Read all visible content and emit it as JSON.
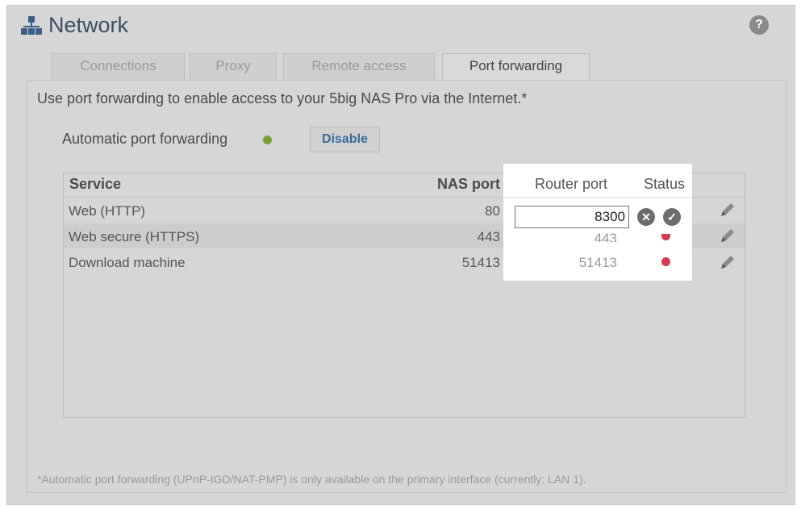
{
  "window": {
    "title": "Network",
    "help_label": "?"
  },
  "tabs": [
    {
      "label": "Connections",
      "active": false
    },
    {
      "label": "Proxy",
      "active": false
    },
    {
      "label": "Remote access",
      "active": false
    },
    {
      "label": "Port forwarding",
      "active": true
    }
  ],
  "main": {
    "intro": "Use port forwarding to enable access to your 5big NAS Pro via the Internet.*",
    "auto_forwarding": {
      "label": "Automatic port forwarding",
      "status_color": "#7aa03a",
      "button_label": "Disable"
    },
    "table": {
      "headers": {
        "service": "Service",
        "nas_port": "NAS port",
        "router_port": "Router port",
        "status": "Status"
      },
      "rows": [
        {
          "service": "Web (HTTP)",
          "nas_port": "80",
          "router_port": "",
          "editing_value": "8300",
          "status_color": "#d33c4a"
        },
        {
          "service": "Web secure (HTTPS)",
          "nas_port": "443",
          "router_port": "443",
          "status_color": "#d33c4a"
        },
        {
          "service": "Download machine",
          "nas_port": "51413",
          "router_port": "51413",
          "status_color": "#d33c4a"
        }
      ],
      "cancel_icon": "✕",
      "confirm_icon": "✓"
    },
    "footnote": "*Automatic port forwarding (UPnP-IGD/NAT-PMP) is only available on the primary interface (currently: LAN 1)."
  },
  "colors": {
    "accent": "#3d6b9a",
    "background": "#d6d6d6",
    "highlight": "#ffffff",
    "status_off": "#d33c4a"
  }
}
